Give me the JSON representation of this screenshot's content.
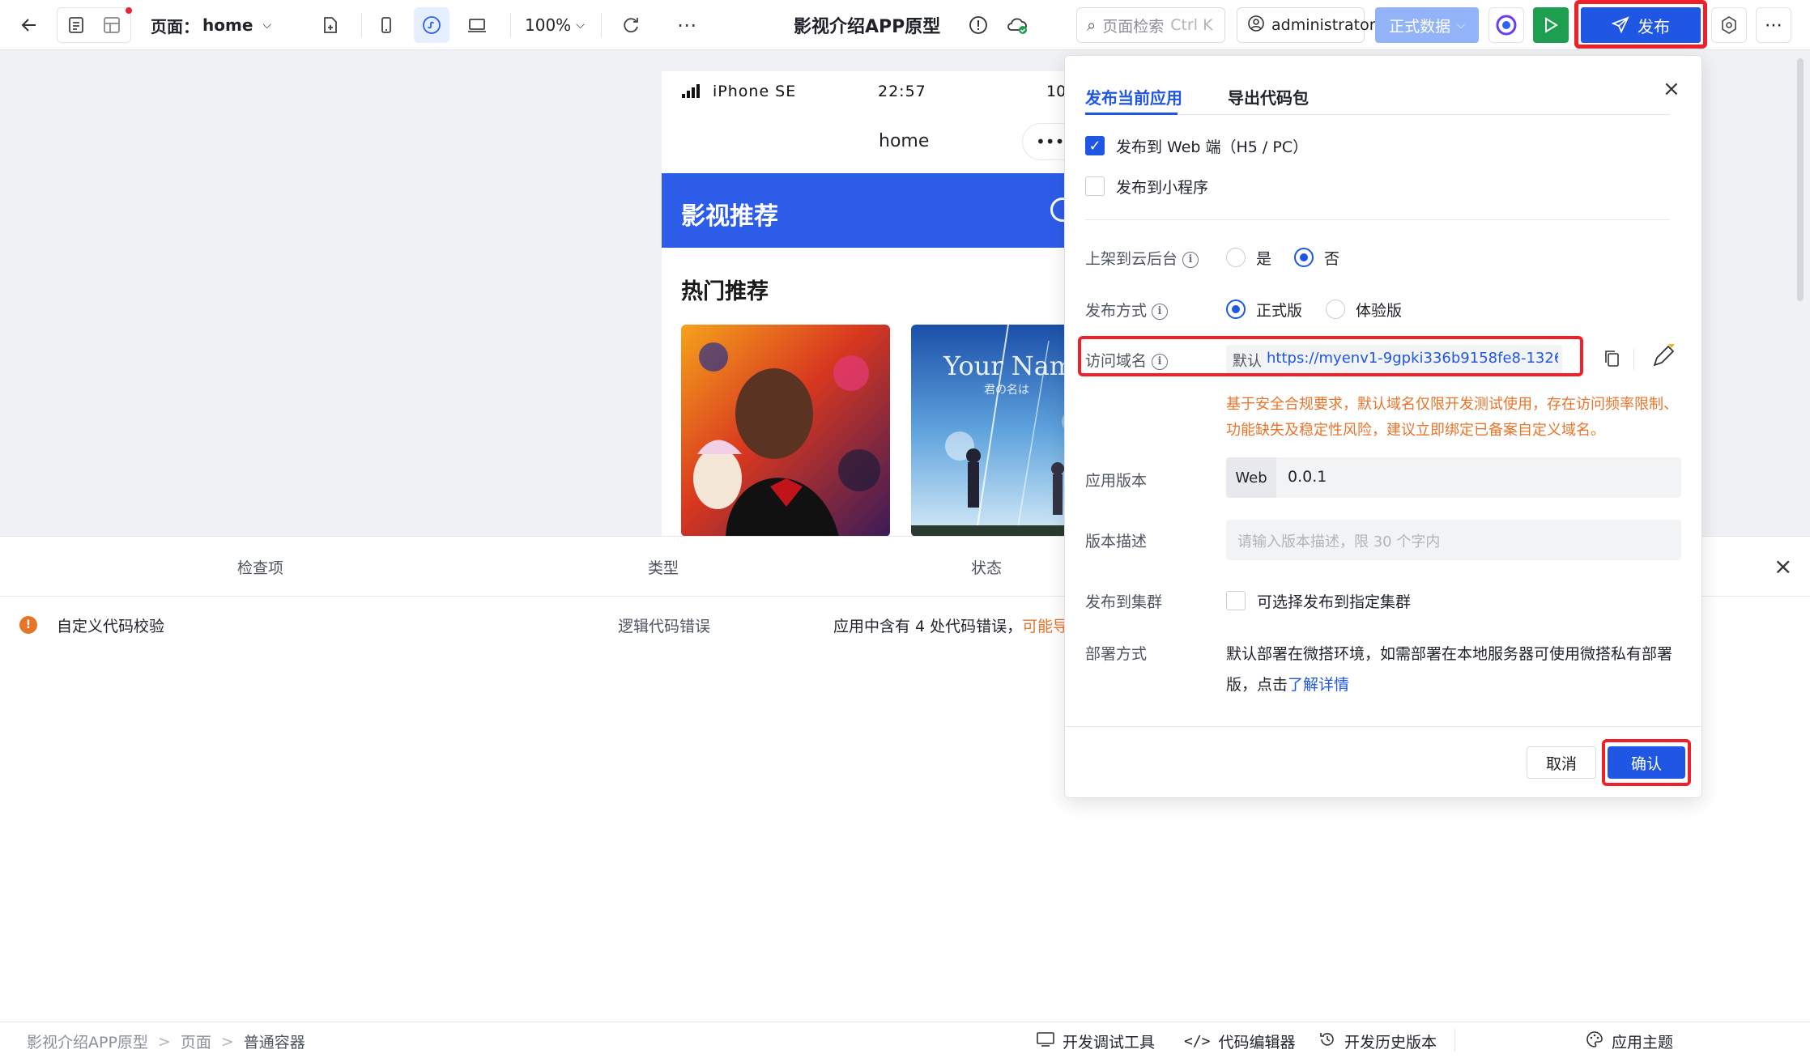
{
  "toolbar": {
    "page_prefix": "页面：",
    "page_name": "home",
    "zoom": "100%",
    "app_title": "影视介绍APP原型",
    "search_placeholder": "页面检索",
    "search_shortcut": "Ctrl K",
    "user": "administrator",
    "data_env": "正式数据",
    "publish_label": "发布"
  },
  "phone": {
    "device": "iPhone SE",
    "time": "22:57",
    "battery_partial": "10",
    "nav_title": "home",
    "more_dots": "•••",
    "banner_title": "影视推荐",
    "section_title": "热门推荐",
    "poster2_title": "Your Nam",
    "poster2_subtitle": "君の名は"
  },
  "dialog": {
    "tabs": [
      "发布当前应用",
      "导出代码包"
    ],
    "close": "×",
    "publish_web": "发布到 Web 端（H5 / PC）",
    "publish_web_checked": true,
    "publish_miniprogram": "发布到小程序",
    "publish_miniprogram_checked": false,
    "cloud_label": "上架到云后台",
    "cloud_yes": "是",
    "cloud_no": "否",
    "cloud_selected": "否",
    "method_label": "发布方式",
    "method_official": "正式版",
    "method_trial": "体验版",
    "method_selected": "正式版",
    "domain_label": "访问域名",
    "domain_tag": "默认",
    "domain_url": "https://myenv1-9gpki336b9158fe8-13268...",
    "domain_warning": "基于安全合规要求，默认域名仅限开发测试使用，存在访问频率限制、功能缺失及稳定性风险，建议立即绑定已备案自定义域名。",
    "version_label": "应用版本",
    "version_prefix": "Web",
    "version_value": "0.0.1",
    "desc_label": "版本描述",
    "desc_placeholder": "请输入版本描述，限 30 个字内",
    "cluster_label": "发布到集群",
    "cluster_option": "可选择发布到指定集群",
    "deploy_label": "部署方式",
    "deploy_text_1": "默认部署在微搭环境，如需部署在本地服务器可使用微搭私有部署",
    "deploy_text_2": "版，点击",
    "deploy_link": "了解详情",
    "cancel": "取消",
    "confirm": "确认"
  },
  "panel": {
    "headers": [
      "检查项",
      "类型",
      "状态"
    ],
    "close": "×",
    "rows": [
      {
        "item": "自定义代码校验",
        "type": "逻辑代码错误",
        "status_text": "应用中含有 4 处代码错误，",
        "status_link": "可能导"
      }
    ]
  },
  "statusbar": {
    "breadcrumb": [
      "影视介绍APP原型",
      "页面",
      "普通容器"
    ],
    "sep": ">",
    "tools": [
      "开发调试工具",
      "代码编辑器",
      "开发历史版本"
    ],
    "theme": "应用主题"
  },
  "colors": {
    "primary": "#1f56e3",
    "warning_orange": "#e8742a",
    "highlight_red": "#f0202a",
    "play_green": "#1e9e4f"
  }
}
